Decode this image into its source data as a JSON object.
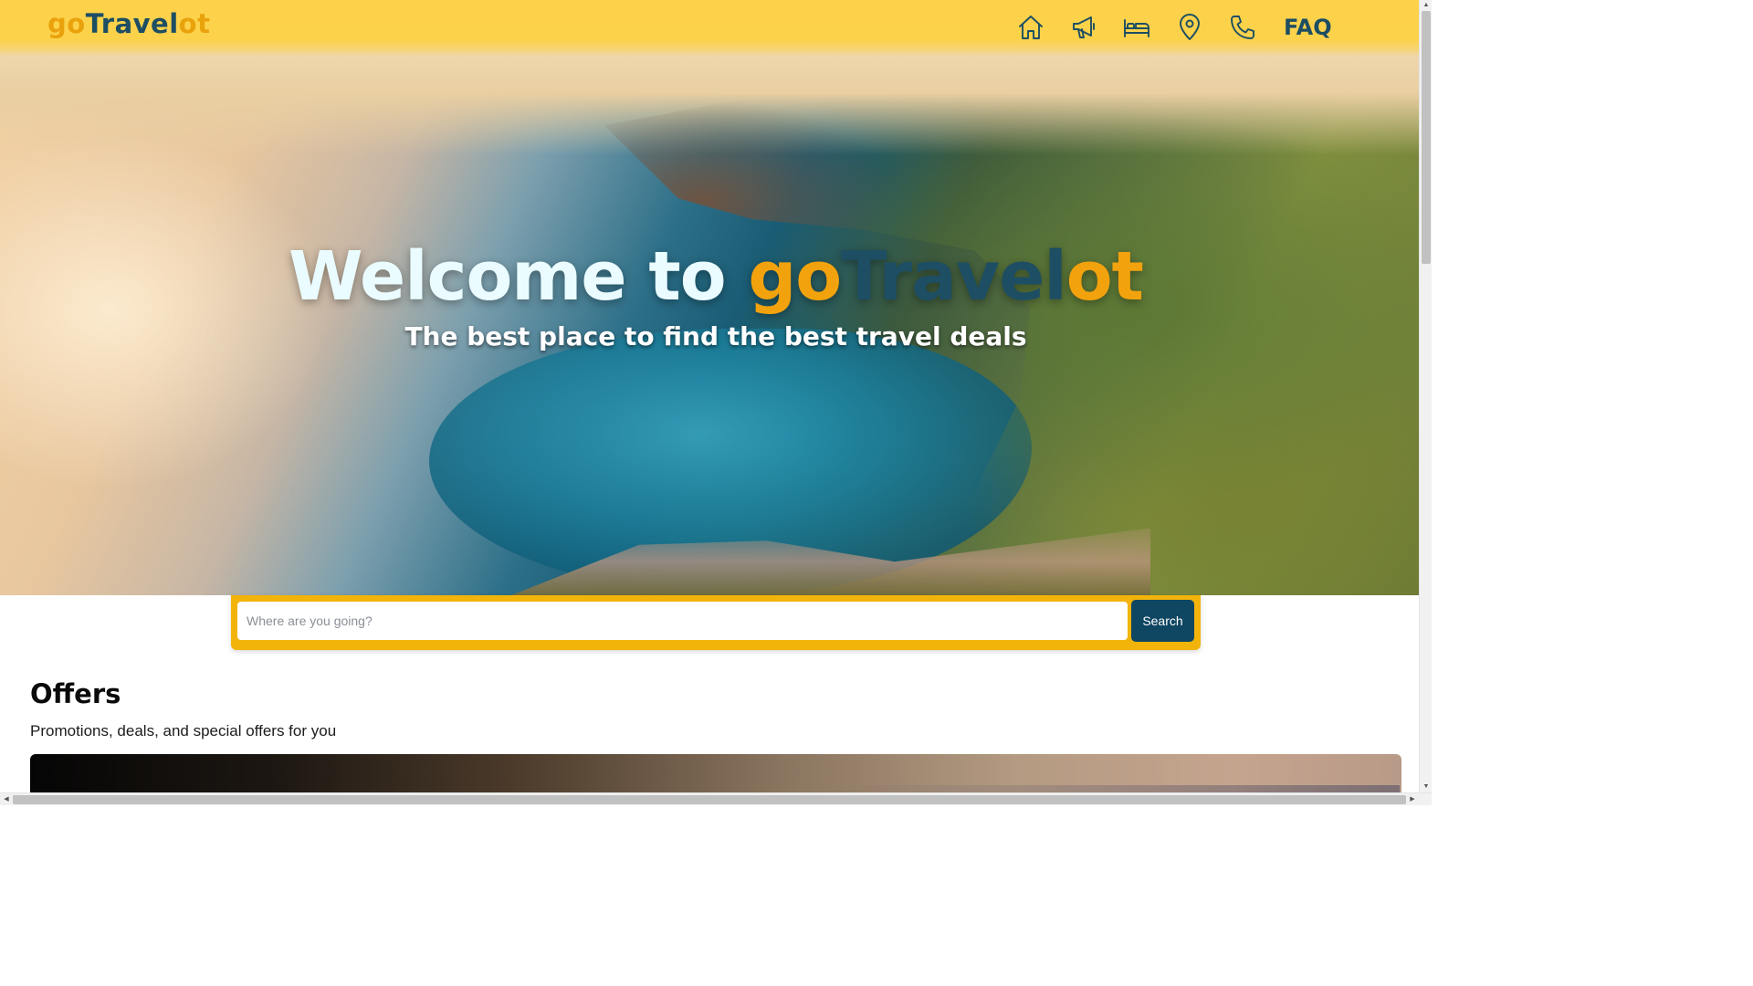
{
  "brand": {
    "logo_part1": "go",
    "logo_part2": "Travel",
    "logo_part3": "ot",
    "primary_color": "#fcd24b",
    "accent_color": "#f2a20d",
    "dark_color": "#1d4e63"
  },
  "nav": {
    "icons": [
      "home-icon",
      "megaphone-icon",
      "bed-icon",
      "map-pin-icon",
      "phone-icon"
    ],
    "faq_label": "FAQ"
  },
  "hero": {
    "title_welcome": "Welcome to ",
    "title_go": "go",
    "title_travel": "Travel",
    "title_ot": "ot",
    "subtitle": "The best place to find the best travel deals"
  },
  "search": {
    "placeholder": "Where are you going?",
    "button_label": "Search"
  },
  "offers": {
    "title": "Offers",
    "subtitle": "Promotions, deals, and special offers for you"
  }
}
